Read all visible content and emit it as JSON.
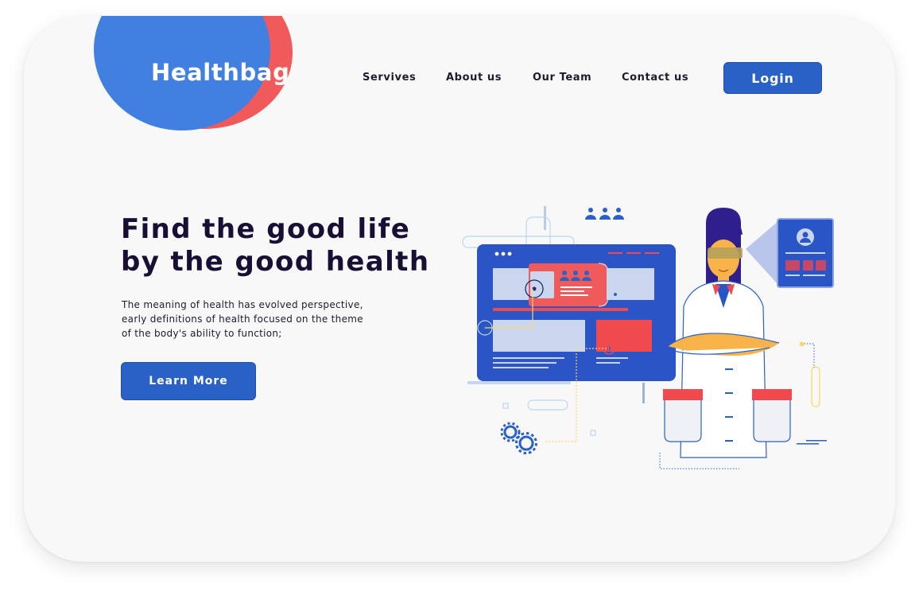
{
  "brand": {
    "name": "Healthbag"
  },
  "nav": {
    "items": [
      {
        "label": "Servives"
      },
      {
        "label": "About us"
      },
      {
        "label": "Our Team"
      },
      {
        "label": "Contact us"
      }
    ],
    "login_label": "Login"
  },
  "hero": {
    "headline_line1": "Find the good life",
    "headline_line2": "by the good health",
    "description_line1": "The meaning of health has evolved perspective,",
    "description_line2": "early definitions of health focused on the theme",
    "description_line3": "of the body's ability to function;",
    "cta_label": "Learn More"
  },
  "colors": {
    "primary_blue": "#2a61c7",
    "logo_blue": "#4180e0",
    "logo_red": "#f05a5b",
    "heading_text": "#190f34",
    "card_background": "#f8f8f9"
  },
  "icons": [
    "user-group-icon",
    "profile-card-icon",
    "gear-icon",
    "doctor-illustration"
  ]
}
